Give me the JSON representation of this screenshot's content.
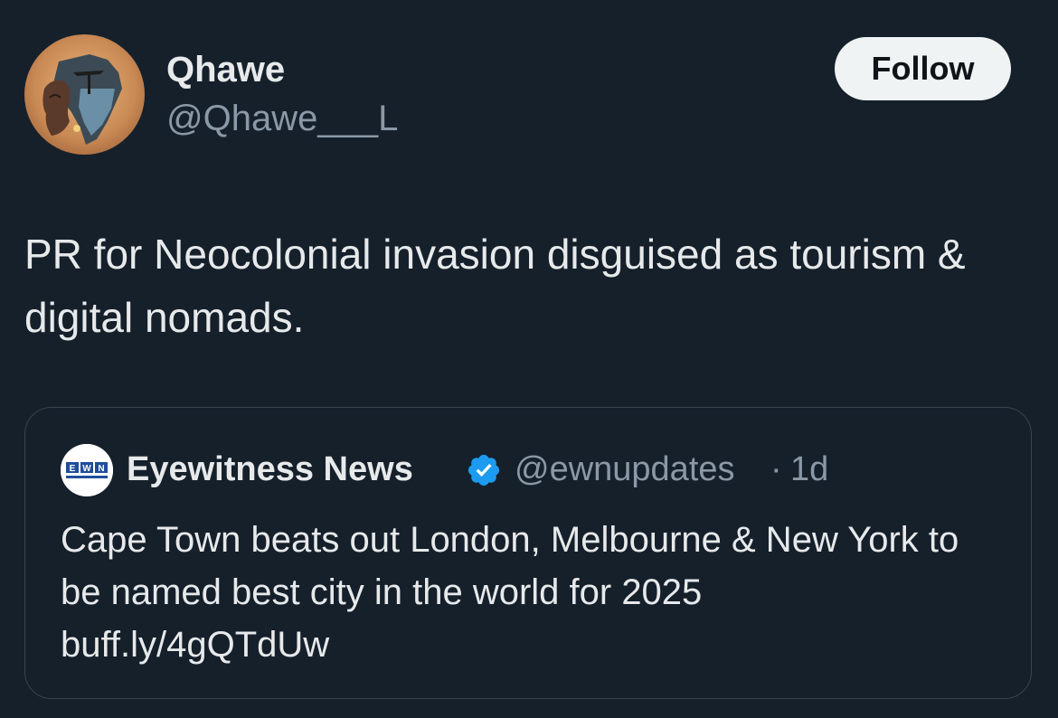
{
  "post": {
    "author": {
      "display_name": "Qhawe",
      "handle": "@Qhawe___L",
      "avatar_icon": "africa-map-portrait-avatar"
    },
    "follow_label": "Follow",
    "text": "PR for Neocolonial invasion disguised as tourism & digital nomads."
  },
  "quoted_post": {
    "author": {
      "display_name": "Eyewitness News",
      "handle": "@ewnupdates",
      "avatar_icon": "ewn-logo",
      "verified_icon": "verified-badge-icon",
      "logo_text": "EWN",
      "logo_subtext": "EYEWITNESS NEWS"
    },
    "separator": "·",
    "time": "1d",
    "text": "Cape Town beats out London, Melbourne & New York to be named best city in the world for 2025",
    "link": "buff.ly/4gQTdUw"
  },
  "colors": {
    "background": "#15202b",
    "primary_text": "#e7e9ea",
    "secondary_text": "#8b98a5",
    "border": "#38444d",
    "verified_blue": "#1d9bf0",
    "follow_bg": "#eff3f4"
  }
}
